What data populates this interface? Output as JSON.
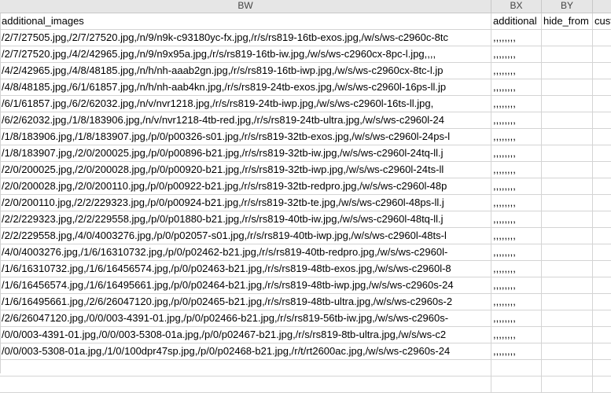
{
  "columns": {
    "bw": "BW",
    "bx": "BX",
    "by": "BY"
  },
  "header_row": {
    "bw": "additional_images",
    "bx": "additional",
    "by": "hide_from",
    "bz": "cust"
  },
  "rows": [
    {
      "bw": "/2/7/27505.jpg,/2/7/27520.jpg,/n/9/n9k-c93180yc-fx.jpg,/r/s/rs819-16tb-exos.jpg,/w/s/ws-c2960c-8tc",
      "bx": ",,,,,,,,"
    },
    {
      "bw": "/2/7/27520.jpg,/4/2/42965.jpg,/n/9/n9x95a.jpg,/r/s/rs819-16tb-iw.jpg,/w/s/ws-c2960cx-8pc-l.jpg,,,,",
      "bx": ",,,,,,,,"
    },
    {
      "bw": "/4/2/42965.jpg,/4/8/48185.jpg,/n/h/nh-aaab2gn.jpg,/r/s/rs819-16tb-iwp.jpg,/w/s/ws-c2960cx-8tc-l.jp",
      "bx": ",,,,,,,,"
    },
    {
      "bw": "/4/8/48185.jpg,/6/1/61857.jpg,/n/h/nh-aab4kn.jpg,/r/s/rs819-24tb-exos.jpg,/w/s/ws-c2960l-16ps-ll.jp",
      "bx": ",,,,,,,,"
    },
    {
      "bw": "/6/1/61857.jpg,/6/2/62032.jpg,/n/v/nvr1218.jpg,/r/s/rs819-24tb-iwp.jpg,/w/s/ws-c2960l-16ts-ll.jpg,",
      "bx": ",,,,,,,,"
    },
    {
      "bw": "/6/2/62032.jpg,/1/8/183906.jpg,/n/v/nvr1218-4tb-red.jpg,/r/s/rs819-24tb-ultra.jpg,/w/s/ws-c2960l-24",
      "bx": ",,,,,,,,"
    },
    {
      "bw": "/1/8/183906.jpg,/1/8/183907.jpg,/p/0/p00326-s01.jpg,/r/s/rs819-32tb-exos.jpg,/w/s/ws-c2960l-24ps-l",
      "bx": ",,,,,,,,"
    },
    {
      "bw": "/1/8/183907.jpg,/2/0/200025.jpg,/p/0/p00896-b21.jpg,/r/s/rs819-32tb-iw.jpg,/w/s/ws-c2960l-24tq-ll.j",
      "bx": ",,,,,,,,"
    },
    {
      "bw": "/2/0/200025.jpg,/2/0/200028.jpg,/p/0/p00920-b21.jpg,/r/s/rs819-32tb-iwp.jpg,/w/s/ws-c2960l-24ts-ll",
      "bx": ",,,,,,,,"
    },
    {
      "bw": "/2/0/200028.jpg,/2/0/200110.jpg,/p/0/p00922-b21.jpg,/r/s/rs819-32tb-redpro.jpg,/w/s/ws-c2960l-48p",
      "bx": ",,,,,,,,"
    },
    {
      "bw": "/2/0/200110.jpg,/2/2/229323.jpg,/p/0/p00924-b21.jpg,/r/s/rs819-32tb-te.jpg,/w/s/ws-c2960l-48ps-ll.j",
      "bx": ",,,,,,,,"
    },
    {
      "bw": "/2/2/229323.jpg,/2/2/229558.jpg,/p/0/p01880-b21.jpg,/r/s/rs819-40tb-iw.jpg,/w/s/ws-c2960l-48tq-ll.j",
      "bx": ",,,,,,,,"
    },
    {
      "bw": "/2/2/229558.jpg,/4/0/4003276.jpg,/p/0/p02057-s01.jpg,/r/s/rs819-40tb-iwp.jpg,/w/s/ws-c2960l-48ts-l",
      "bx": ",,,,,,,,"
    },
    {
      "bw": "/4/0/4003276.jpg,/1/6/16310732.jpg,/p/0/p02462-b21.jpg,/r/s/rs819-40tb-redpro.jpg,/w/s/ws-c2960l-",
      "bx": ",,,,,,,,"
    },
    {
      "bw": "/1/6/16310732.jpg,/1/6/16456574.jpg,/p/0/p02463-b21.jpg,/r/s/rs819-48tb-exos.jpg,/w/s/ws-c2960l-8",
      "bx": ",,,,,,,,"
    },
    {
      "bw": "/1/6/16456574.jpg,/1/6/16495661.jpg,/p/0/p02464-b21.jpg,/r/s/rs819-48tb-iwp.jpg,/w/s/ws-c2960s-24",
      "bx": ",,,,,,,,"
    },
    {
      "bw": "/1/6/16495661.jpg,/2/6/26047120.jpg,/p/0/p02465-b21.jpg,/r/s/rs819-48tb-ultra.jpg,/w/s/ws-c2960s-2",
      "bx": ",,,,,,,,"
    },
    {
      "bw": "/2/6/26047120.jpg,/0/0/003-4391-01.jpg,/p/0/p02466-b21.jpg,/r/s/rs819-56tb-iw.jpg,/w/s/ws-c2960s-",
      "bx": ",,,,,,,,"
    },
    {
      "bw": "/0/0/003-4391-01.jpg,/0/0/003-5308-01a.jpg,/p/0/p02467-b21.jpg,/r/s/rs819-8tb-ultra.jpg,/w/s/ws-c2",
      "bx": ",,,,,,,,"
    },
    {
      "bw": "/0/0/003-5308-01a.jpg,/1/0/100dpr47sp.jpg,/p/0/p02468-b21.jpg,/r/t/rt2600ac.jpg,/w/s/ws-c2960s-24",
      "bx": ",,,,,,,,"
    },
    {
      "bw": "",
      "bx": ""
    },
    {
      "bw": "",
      "bx": ""
    }
  ]
}
